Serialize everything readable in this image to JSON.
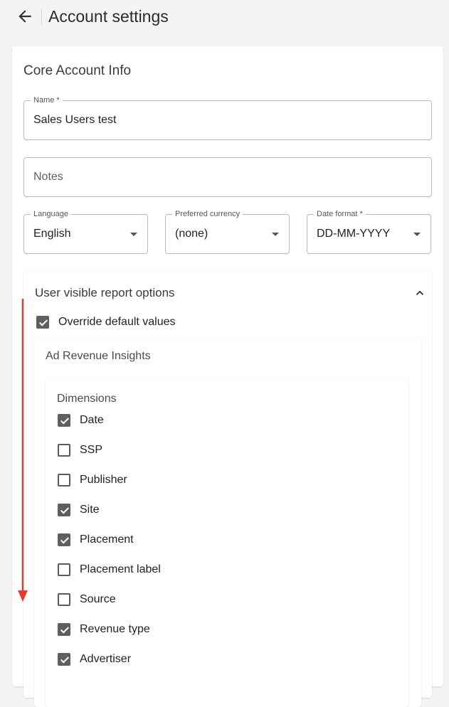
{
  "header": {
    "title": "Account settings"
  },
  "core": {
    "title": "Core Account Info",
    "name": {
      "label": "Name *",
      "value": "Sales Users test"
    },
    "notes": {
      "placeholder": "Notes"
    },
    "language": {
      "label": "Language",
      "value": "English"
    },
    "currency": {
      "label": "Preferred currency",
      "value": "(none)"
    },
    "date_format": {
      "label": "Date format *",
      "value": "DD-MM-YYYY"
    }
  },
  "report_options": {
    "title": "User visible report options",
    "override": {
      "label": "Override default values",
      "checked": true
    },
    "section_title": "Ad Revenue Insights",
    "dimensions": {
      "title": "Dimensions",
      "items": [
        {
          "label": "Date",
          "checked": true
        },
        {
          "label": "SSP",
          "checked": false
        },
        {
          "label": "Publisher",
          "checked": false
        },
        {
          "label": "Site",
          "checked": true
        },
        {
          "label": "Placement",
          "checked": true
        },
        {
          "label": "Placement label",
          "checked": false
        },
        {
          "label": "Source",
          "checked": false
        },
        {
          "label": "Revenue type",
          "checked": true
        },
        {
          "label": "Advertiser",
          "checked": true
        }
      ]
    }
  },
  "colors": {
    "annotation_arrow": "#e53b2c",
    "checkbox_checked": "#5f5f5f"
  }
}
